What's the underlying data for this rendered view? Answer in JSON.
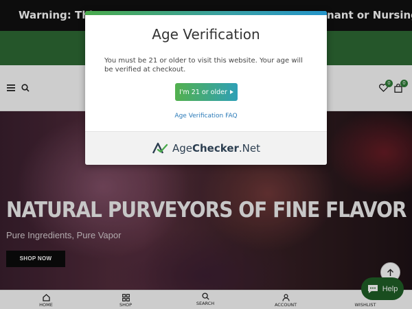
{
  "warning": {
    "text_left": "Warning: This p",
    "text_right": "nant or Nursing"
  },
  "header": {
    "wishlist_count": "0",
    "cart_count": "0"
  },
  "hero": {
    "title": "NATURAL PURVEYORS OF FINE FLAVOR",
    "subtitle": "Pure Ingredients, Pure Vapor",
    "cta_label": "SHOP NOW"
  },
  "help_button": {
    "label": "Help"
  },
  "bottom_nav": {
    "items": [
      {
        "label": "HOME",
        "icon": "home-icon"
      },
      {
        "label": "SHOP",
        "icon": "grid-icon"
      },
      {
        "label": "SEARCH",
        "icon": "search-icon"
      },
      {
        "label": "ACCOUNT",
        "icon": "user-icon"
      },
      {
        "label": "WISHLIST",
        "icon": "heart-icon"
      }
    ]
  },
  "modal": {
    "title": "Age Verification",
    "text": "You must be 21 or older to visit this website. Your age will be verified at checkout.",
    "confirm_label": "I'm 21 or older",
    "faq_link": "Age Verification FAQ",
    "brand_prefix": "Age",
    "brand_bold": "Checker",
    "brand_suffix": ".Net"
  },
  "colors": {
    "accent_green": "#2e6a34",
    "modal_gradient_start": "#4aaa4c",
    "modal_gradient_end": "#2494c9",
    "link_blue": "#2a7ab8"
  }
}
